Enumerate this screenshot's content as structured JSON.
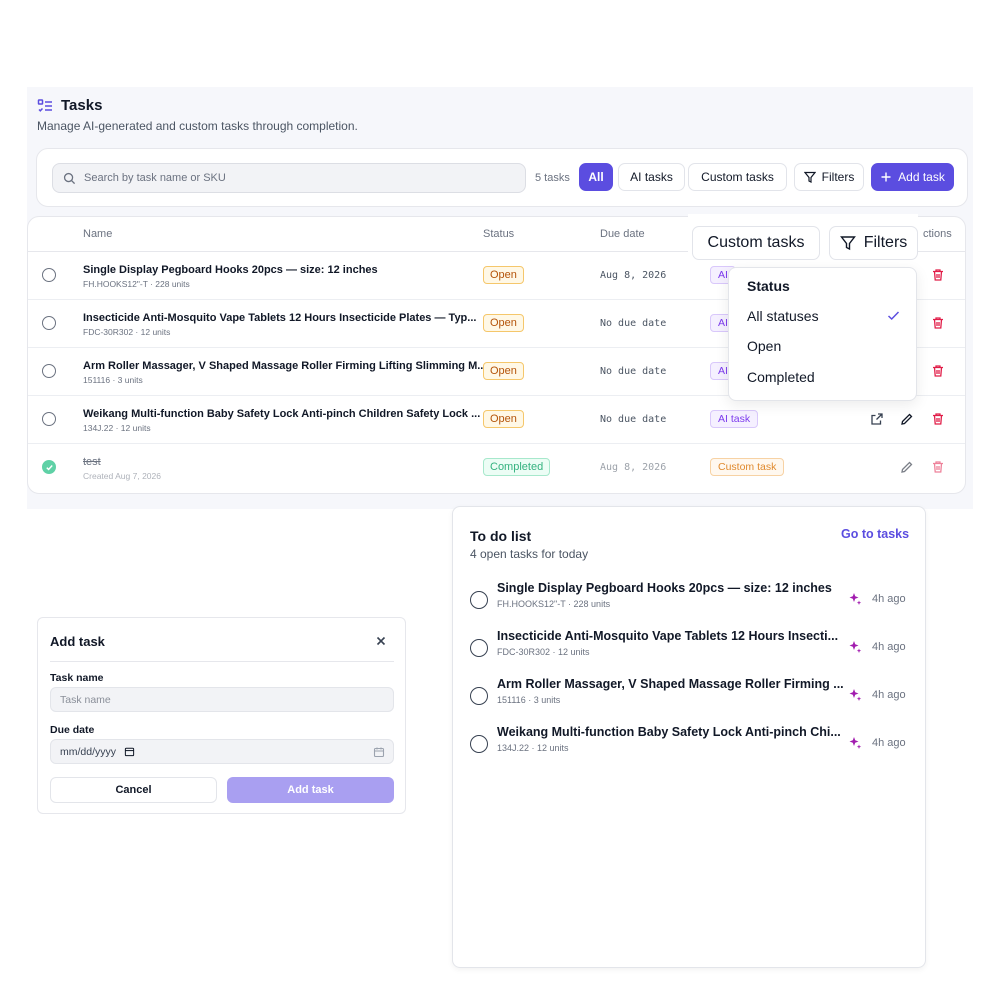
{
  "tasks": {
    "title": "Tasks",
    "subtitle": "Manage AI-generated and custom tasks through completion.",
    "search_placeholder": "Search by task name or SKU",
    "count": "5 tasks",
    "filters": {
      "all": "All",
      "ai": "AI tasks",
      "custom": "Custom tasks",
      "filters": "Filters",
      "add": "Add task"
    },
    "columns": {
      "name": "Name",
      "status": "Status",
      "due": "Due date",
      "actions": "ctions"
    },
    "rows": [
      {
        "name": "Single Display Pegboard Hooks 20pcs — size: 12 inches",
        "meta": "FH.HOOKS12\"-T · 228 units",
        "status": "Open",
        "due": "Aug 8, 2026",
        "type": "AI"
      },
      {
        "name": "Insecticide Anti-Mosquito Vape Tablets 12 Hours Insecticide Plates — Typ...",
        "meta": "FDC-30R302 · 12 units",
        "status": "Open",
        "due": "No due date",
        "type": "AI"
      },
      {
        "name": "Arm Roller Massager, V Shaped Massage Roller Firming Lifting Slimming M...",
        "meta": "151116 · 3 units",
        "status": "Open",
        "due": "No due date",
        "type": "AI"
      },
      {
        "name": "Weikang Multi-function Baby Safety Lock Anti-pinch Children Safety Lock ...",
        "meta": "134J.22 · 12 units",
        "status": "Open",
        "due": "No due date",
        "type": "AI task"
      },
      {
        "name": "test",
        "meta": "Created Aug 7, 2026",
        "status": "Completed",
        "due": "Aug 8, 2026",
        "type": "Custom task"
      }
    ],
    "overlay": {
      "custom": "Custom tasks",
      "filters": "Filters"
    },
    "dropdown": {
      "header": "Status",
      "options": [
        "All statuses",
        "Open",
        "Completed"
      ],
      "selected": "All statuses"
    }
  },
  "modal": {
    "title": "Add task",
    "task_name_label": "Task name",
    "task_name_placeholder": "Task name",
    "due_label": "Due date",
    "due_value": "mm/dd/yyyy",
    "cancel": "Cancel",
    "add": "Add task"
  },
  "todo": {
    "title": "To do list",
    "subtitle": "4 open tasks for today",
    "link": "Go to tasks",
    "items": [
      {
        "name": "Single Display Pegboard Hooks 20pcs — size: 12 inches",
        "meta": "FH.HOOKS12\"-T · 228 units",
        "time": "4h ago"
      },
      {
        "name": "Insecticide Anti-Mosquito Vape Tablets 12 Hours Insecti...",
        "meta": "FDC-30R302 · 12 units",
        "time": "4h ago"
      },
      {
        "name": "Arm Roller Massager, V Shaped Massage Roller Firming ...",
        "meta": "151116 · 3 units",
        "time": "4h ago"
      },
      {
        "name": "Weikang Multi-function Baby Safety Lock Anti-pinch Chi...",
        "meta": "134J.22 · 12 units",
        "time": "4h ago"
      }
    ]
  },
  "colors": {
    "accent": "#5b4de0",
    "open": "#b45309",
    "completed": "#34b27f",
    "ai": "#7c3aed",
    "custom": "#e08a2e",
    "danger": "#e11d48"
  },
  "icons": {
    "tasks": "list-check-icon",
    "search": "search-icon",
    "filter": "filter-icon",
    "plus": "plus-icon",
    "external": "external-link-icon",
    "edit": "pencil-icon",
    "delete": "trash-icon",
    "close": "close-icon",
    "calendar": "calendar-icon",
    "spark": "sparkle-icon",
    "check": "check-icon"
  }
}
